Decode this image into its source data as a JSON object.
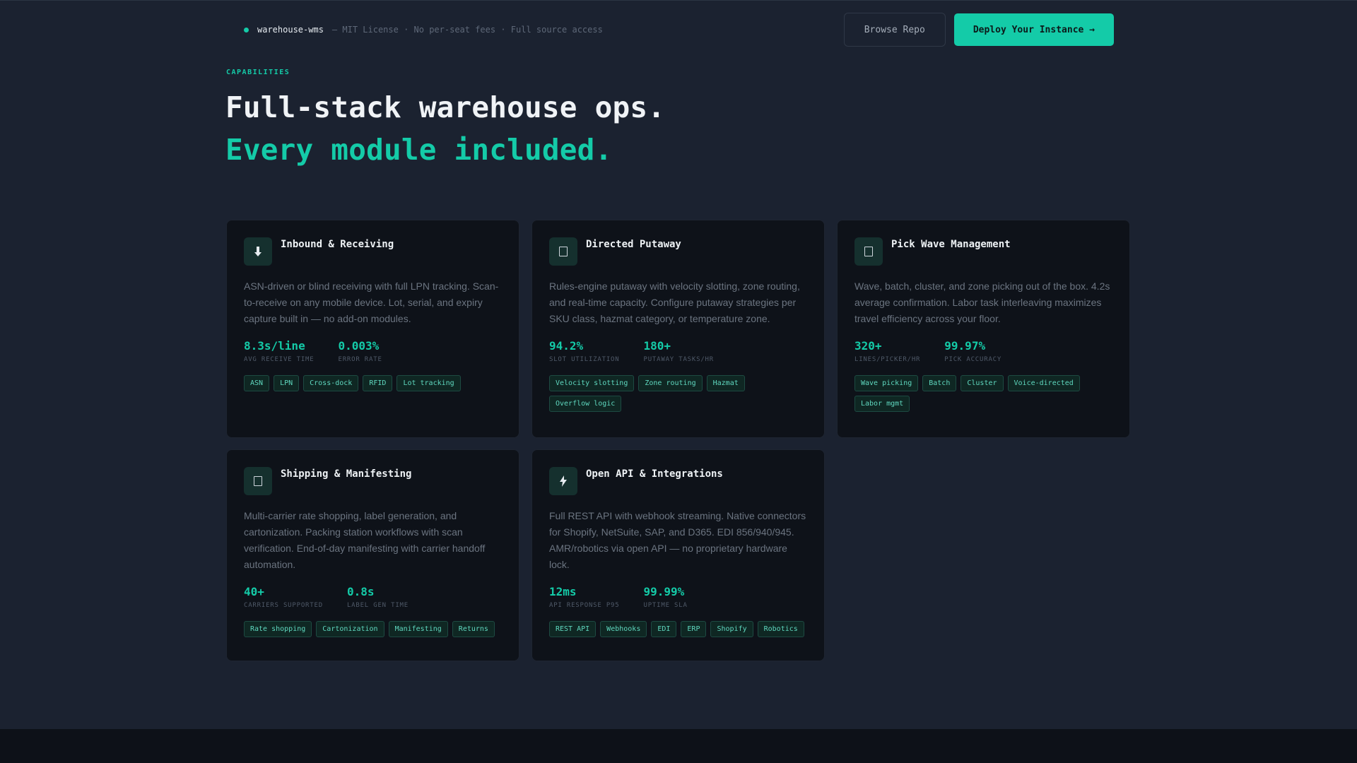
{
  "header": {
    "brand_name": "warehouse-wms",
    "brand_meta": "— MIT License · No per-seat fees · Full source access",
    "browse_label": "Browse Repo",
    "deploy_label": "Deploy Your Instance →"
  },
  "hero": {
    "eyebrow": "CAPABILITIES",
    "title_line1": "Full-stack warehouse ops.",
    "title_line2": "Every module included."
  },
  "cards": [
    {
      "icon": "arrow-down-icon",
      "title": "Inbound & Receiving",
      "desc": "ASN-driven or blind receiving with full LPN tracking. Scan-to-receive on any mobile device. Lot, serial, and expiry capture built in — no add-on modules.",
      "stats": [
        {
          "value": "8.3s/line",
          "label": "AVG RECEIVE TIME"
        },
        {
          "value": "0.003%",
          "label": "ERROR RATE"
        }
      ],
      "tags": [
        "ASN",
        "LPN",
        "Cross-dock",
        "RFID",
        "Lot tracking"
      ]
    },
    {
      "icon": "box-icon",
      "title": "Directed Putaway",
      "desc": "Rules-engine putaway with velocity slotting, zone routing, and real-time capacity. Configure putaway strategies per SKU class, hazmat category, or temperature zone.",
      "stats": [
        {
          "value": "94.2%",
          "label": "SLOT UTILIZATION"
        },
        {
          "value": "180+",
          "label": "PUTAWAY TASKS/HR"
        }
      ],
      "tags": [
        "Velocity slotting",
        "Zone routing",
        "Hazmat",
        "Overflow logic"
      ]
    },
    {
      "icon": "box-icon",
      "title": "Pick Wave Management",
      "desc": "Wave, batch, cluster, and zone picking out of the box. 4.2s average confirmation. Labor task interleaving maximizes travel efficiency across your floor.",
      "stats": [
        {
          "value": "320+",
          "label": "LINES/PICKER/HR"
        },
        {
          "value": "99.97%",
          "label": "PICK ACCURACY"
        }
      ],
      "tags": [
        "Wave picking",
        "Batch",
        "Cluster",
        "Voice-directed",
        "Labor mgmt"
      ]
    },
    {
      "icon": "box-icon",
      "title": "Shipping & Manifesting",
      "desc": "Multi-carrier rate shopping, label generation, and cartonization. Packing station workflows with scan verification. End-of-day manifesting with carrier handoff automation.",
      "stats": [
        {
          "value": "40+",
          "label": "CARRIERS SUPPORTED"
        },
        {
          "value": "0.8s",
          "label": "LABEL GEN TIME"
        }
      ],
      "tags": [
        "Rate shopping",
        "Cartonization",
        "Manifesting",
        "Returns"
      ]
    },
    {
      "icon": "lightning-icon",
      "title": "Open API & Integrations",
      "desc": "Full REST API with webhook streaming. Native connectors for Shopify, NetSuite, SAP, and D365. EDI 856/940/945. AMR/robotics via open API — no proprietary hardware lock.",
      "stats": [
        {
          "value": "12ms",
          "label": "API RESPONSE P95"
        },
        {
          "value": "99.99%",
          "label": "UPTIME SLA"
        }
      ],
      "tags": [
        "REST API",
        "Webhooks",
        "EDI",
        "ERP",
        "Shopify",
        "Robotics"
      ]
    }
  ]
}
